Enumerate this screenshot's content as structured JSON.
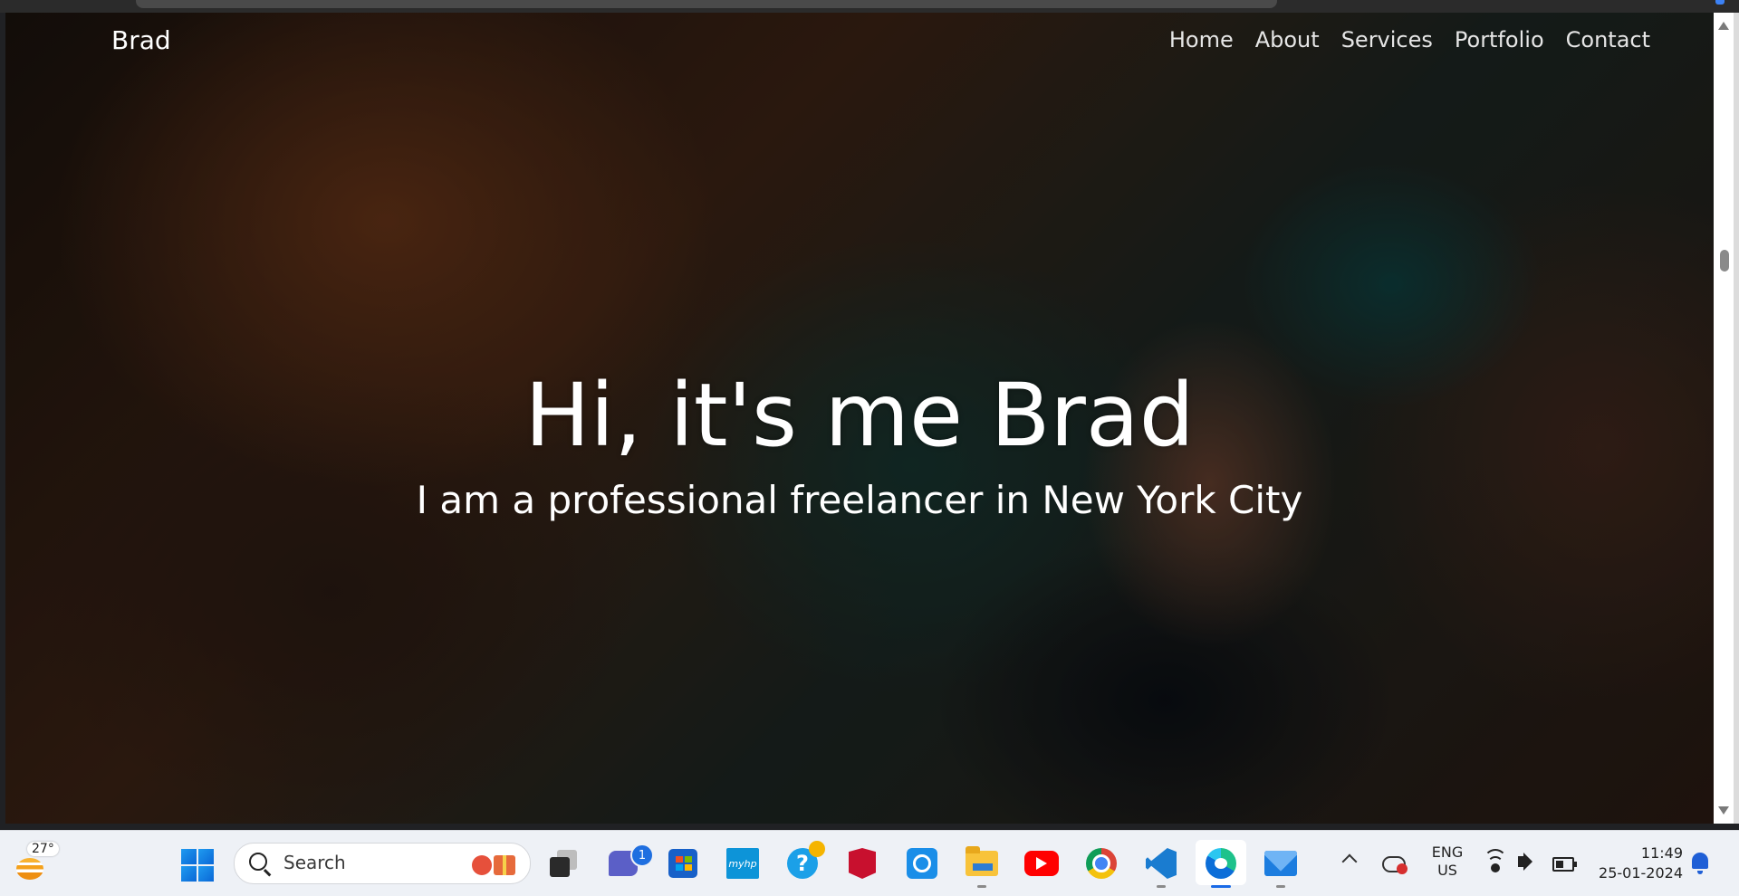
{
  "site": {
    "brand": "Brad",
    "nav": [
      "Home",
      "About",
      "Services",
      "Portfolio",
      "Contact"
    ],
    "hero_title": "Hi, it's me Brad",
    "hero_subtitle": "I am a professional freelancer in New York City"
  },
  "taskbar": {
    "weather_temp": "27°",
    "search_placeholder": "Search",
    "teams_badge": "1",
    "myhp_label": "myhp",
    "language_top": "ENG",
    "language_bottom": "US",
    "time": "11:49",
    "date": "25-01-2024",
    "apps": [
      "start-icon",
      "search",
      "task-view-icon",
      "teams-icon",
      "store-icon",
      "myhp-icon",
      "help-icon",
      "mcafee-icon",
      "alexa-icon",
      "file-explorer-icon",
      "youtube-icon",
      "chrome-icon",
      "vscode-icon",
      "edge-icon",
      "mail-icon"
    ]
  },
  "colors": {
    "taskbar_bg": "#eef1f6",
    "accent": "#1a6ae6",
    "hero_text": "#ffffff"
  }
}
